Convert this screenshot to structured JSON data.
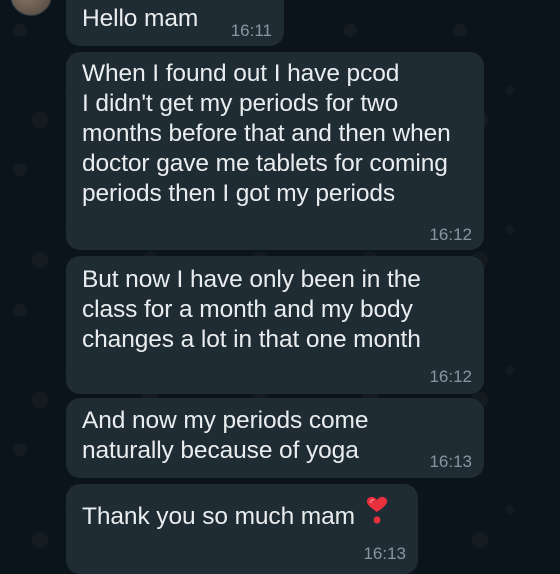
{
  "chat": {
    "messages": [
      {
        "text": "Hello mam",
        "time": "16:11"
      },
      {
        "text": "When I found out I have pcod\nI didn't get my periods for two months before that and then when doctor gave me tablets for coming periods then I got my periods",
        "time": "16:12"
      },
      {
        "text": "But now I have only been in the class for a month and my body changes a lot in that one month",
        "time": "16:12"
      },
      {
        "text": "And now my periods come naturally because of yoga",
        "time": "16:13"
      },
      {
        "text": "Thank you so much mam",
        "emoji": "heart-exclamation-icon",
        "time": "16:13"
      }
    ]
  },
  "colors": {
    "background": "#0b141a",
    "bubble": "#202c33",
    "text": "#e9edef",
    "timestamp": "#8696a0",
    "heart": "#e8303f"
  }
}
